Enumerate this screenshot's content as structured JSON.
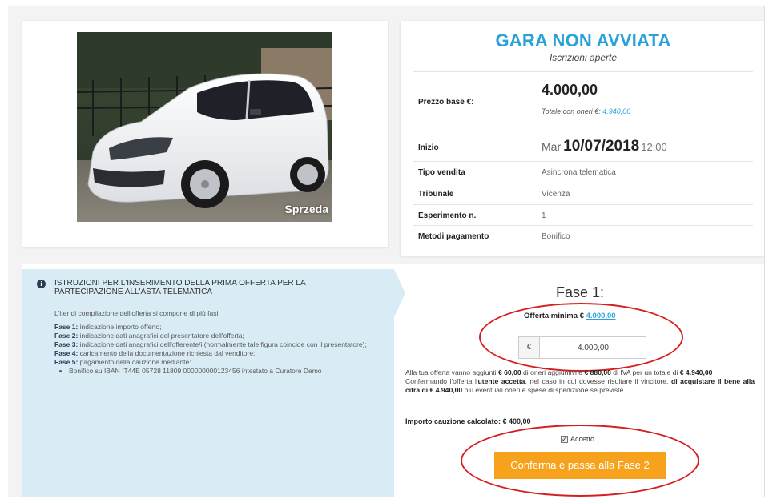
{
  "photo": {
    "watermark": "Sprzeda"
  },
  "status": {
    "title": "GARA NON AVVIATA",
    "subtitle": "Iscrizioni aperte"
  },
  "details": {
    "prezzo_label": "Prezzo base €:",
    "prezzo_value": "4.000,00",
    "totale_prefix": "Totale con oneri €:",
    "totale_value": "4.940,00",
    "inizio_label": "Inizio",
    "inizio_day": "Mar",
    "inizio_date": "10/07/2018",
    "inizio_time": "12:00",
    "tipo_label": "Tipo vendita",
    "tipo_value": "Asincrona telematica",
    "tribunale_label": "Tribunale",
    "tribunale_value": "Vicenza",
    "esperimento_label": "Esperimento n.",
    "esperimento_value": "1",
    "metodi_label": "Metodi pagamento",
    "metodi_value": "Bonifico"
  },
  "instructions": {
    "icon": "info-icon",
    "title": "ISTRUZIONI PER L'INSERIMENTO DELLA PRIMA OFFERTA PER LA PARTECIPAZIONE ALL'ASTA TELEMATICA",
    "intro": "L'iter di compilazione dell'offerta si compone di più fasi:",
    "fasi": [
      {
        "label": "Fase 1:",
        "text": " indicazione importo offerto;"
      },
      {
        "label": "Fase 2:",
        "text": " indicazione dati anagrafici del presentatore dell'offerta;"
      },
      {
        "label": "Fase 3:",
        "text": " indicazione dati anagrafici dell'offerente/i (normalmente tale figura coincide con il presentatore);"
      },
      {
        "label": "Fase 4:",
        "text": " caricamento della documentazione richiesta dal venditore;"
      },
      {
        "label": "Fase 5:",
        "text": " pagamento della cauzione mediante:"
      }
    ],
    "bullet": "Bonifico su IBAN IT44E 05728 11809 000000000123456 intestato a Curatore Demo"
  },
  "offer": {
    "fase_title": "Fase 1:",
    "min_label": "Offerta minima € ",
    "min_value": "4.000,00",
    "currency": "€",
    "amount": "4.000,00",
    "summary": {
      "t1": "Alla tua offerta vanno aggiunti ",
      "oneri": "€ 60,00",
      "t2": " di oneri aggiuntivi e ",
      "iva": "€ 880,00",
      "t3": " di IVA per un totale di ",
      "totale": "€ 4.940,00",
      "t4": "Confermando l'offerta l'",
      "utente": "utente accetta",
      "t5": ", nel caso in cui dovesse risultare il vincitore, ",
      "acquistare": "di acquistare il bene alla cifra di € 4.940,00",
      "t6": " più eventuali oneri e spese di spedizione se previste."
    },
    "cauzione": "Importo cauzione calcolato: € 400,00",
    "accetto_label": "Accetto",
    "accetto_checked": true,
    "confirm_label": "Conferma e passa alla Fase 2"
  },
  "colors": {
    "accent": "#2aa1d9",
    "button": "#f7a21c",
    "annotation": "#d42020",
    "instructions_bg": "#d9ecf6"
  }
}
